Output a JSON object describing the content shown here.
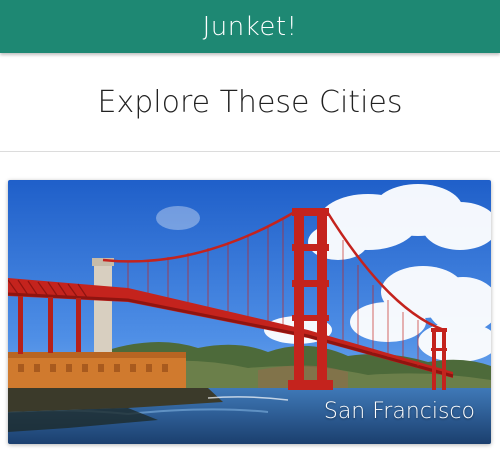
{
  "app": {
    "title": "Junket!",
    "accent_color": "#1e8873"
  },
  "page": {
    "heading": "Explore These Cities"
  },
  "cities": [
    {
      "name": "San Francisco",
      "image": "golden-gate-bridge"
    }
  ]
}
